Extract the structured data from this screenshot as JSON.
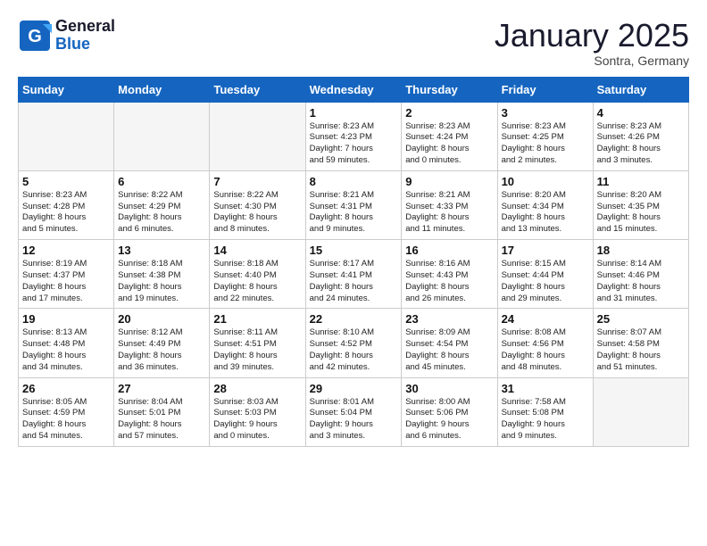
{
  "logo": {
    "general": "General",
    "blue": "Blue"
  },
  "header": {
    "title": "January 2025",
    "subtitle": "Sontra, Germany"
  },
  "weekdays": [
    "Sunday",
    "Monday",
    "Tuesday",
    "Wednesday",
    "Thursday",
    "Friday",
    "Saturday"
  ],
  "weeks": [
    [
      {
        "day": "",
        "info": ""
      },
      {
        "day": "",
        "info": ""
      },
      {
        "day": "",
        "info": ""
      },
      {
        "day": "1",
        "info": "Sunrise: 8:23 AM\nSunset: 4:23 PM\nDaylight: 7 hours\nand 59 minutes."
      },
      {
        "day": "2",
        "info": "Sunrise: 8:23 AM\nSunset: 4:24 PM\nDaylight: 8 hours\nand 0 minutes."
      },
      {
        "day": "3",
        "info": "Sunrise: 8:23 AM\nSunset: 4:25 PM\nDaylight: 8 hours\nand 2 minutes."
      },
      {
        "day": "4",
        "info": "Sunrise: 8:23 AM\nSunset: 4:26 PM\nDaylight: 8 hours\nand 3 minutes."
      }
    ],
    [
      {
        "day": "5",
        "info": "Sunrise: 8:23 AM\nSunset: 4:28 PM\nDaylight: 8 hours\nand 5 minutes."
      },
      {
        "day": "6",
        "info": "Sunrise: 8:22 AM\nSunset: 4:29 PM\nDaylight: 8 hours\nand 6 minutes."
      },
      {
        "day": "7",
        "info": "Sunrise: 8:22 AM\nSunset: 4:30 PM\nDaylight: 8 hours\nand 8 minutes."
      },
      {
        "day": "8",
        "info": "Sunrise: 8:21 AM\nSunset: 4:31 PM\nDaylight: 8 hours\nand 9 minutes."
      },
      {
        "day": "9",
        "info": "Sunrise: 8:21 AM\nSunset: 4:33 PM\nDaylight: 8 hours\nand 11 minutes."
      },
      {
        "day": "10",
        "info": "Sunrise: 8:20 AM\nSunset: 4:34 PM\nDaylight: 8 hours\nand 13 minutes."
      },
      {
        "day": "11",
        "info": "Sunrise: 8:20 AM\nSunset: 4:35 PM\nDaylight: 8 hours\nand 15 minutes."
      }
    ],
    [
      {
        "day": "12",
        "info": "Sunrise: 8:19 AM\nSunset: 4:37 PM\nDaylight: 8 hours\nand 17 minutes."
      },
      {
        "day": "13",
        "info": "Sunrise: 8:18 AM\nSunset: 4:38 PM\nDaylight: 8 hours\nand 19 minutes."
      },
      {
        "day": "14",
        "info": "Sunrise: 8:18 AM\nSunset: 4:40 PM\nDaylight: 8 hours\nand 22 minutes."
      },
      {
        "day": "15",
        "info": "Sunrise: 8:17 AM\nSunset: 4:41 PM\nDaylight: 8 hours\nand 24 minutes."
      },
      {
        "day": "16",
        "info": "Sunrise: 8:16 AM\nSunset: 4:43 PM\nDaylight: 8 hours\nand 26 minutes."
      },
      {
        "day": "17",
        "info": "Sunrise: 8:15 AM\nSunset: 4:44 PM\nDaylight: 8 hours\nand 29 minutes."
      },
      {
        "day": "18",
        "info": "Sunrise: 8:14 AM\nSunset: 4:46 PM\nDaylight: 8 hours\nand 31 minutes."
      }
    ],
    [
      {
        "day": "19",
        "info": "Sunrise: 8:13 AM\nSunset: 4:48 PM\nDaylight: 8 hours\nand 34 minutes."
      },
      {
        "day": "20",
        "info": "Sunrise: 8:12 AM\nSunset: 4:49 PM\nDaylight: 8 hours\nand 36 minutes."
      },
      {
        "day": "21",
        "info": "Sunrise: 8:11 AM\nSunset: 4:51 PM\nDaylight: 8 hours\nand 39 minutes."
      },
      {
        "day": "22",
        "info": "Sunrise: 8:10 AM\nSunset: 4:52 PM\nDaylight: 8 hours\nand 42 minutes."
      },
      {
        "day": "23",
        "info": "Sunrise: 8:09 AM\nSunset: 4:54 PM\nDaylight: 8 hours\nand 45 minutes."
      },
      {
        "day": "24",
        "info": "Sunrise: 8:08 AM\nSunset: 4:56 PM\nDaylight: 8 hours\nand 48 minutes."
      },
      {
        "day": "25",
        "info": "Sunrise: 8:07 AM\nSunset: 4:58 PM\nDaylight: 8 hours\nand 51 minutes."
      }
    ],
    [
      {
        "day": "26",
        "info": "Sunrise: 8:05 AM\nSunset: 4:59 PM\nDaylight: 8 hours\nand 54 minutes."
      },
      {
        "day": "27",
        "info": "Sunrise: 8:04 AM\nSunset: 5:01 PM\nDaylight: 8 hours\nand 57 minutes."
      },
      {
        "day": "28",
        "info": "Sunrise: 8:03 AM\nSunset: 5:03 PM\nDaylight: 9 hours\nand 0 minutes."
      },
      {
        "day": "29",
        "info": "Sunrise: 8:01 AM\nSunset: 5:04 PM\nDaylight: 9 hours\nand 3 minutes."
      },
      {
        "day": "30",
        "info": "Sunrise: 8:00 AM\nSunset: 5:06 PM\nDaylight: 9 hours\nand 6 minutes."
      },
      {
        "day": "31",
        "info": "Sunrise: 7:58 AM\nSunset: 5:08 PM\nDaylight: 9 hours\nand 9 minutes."
      },
      {
        "day": "",
        "info": ""
      }
    ]
  ]
}
